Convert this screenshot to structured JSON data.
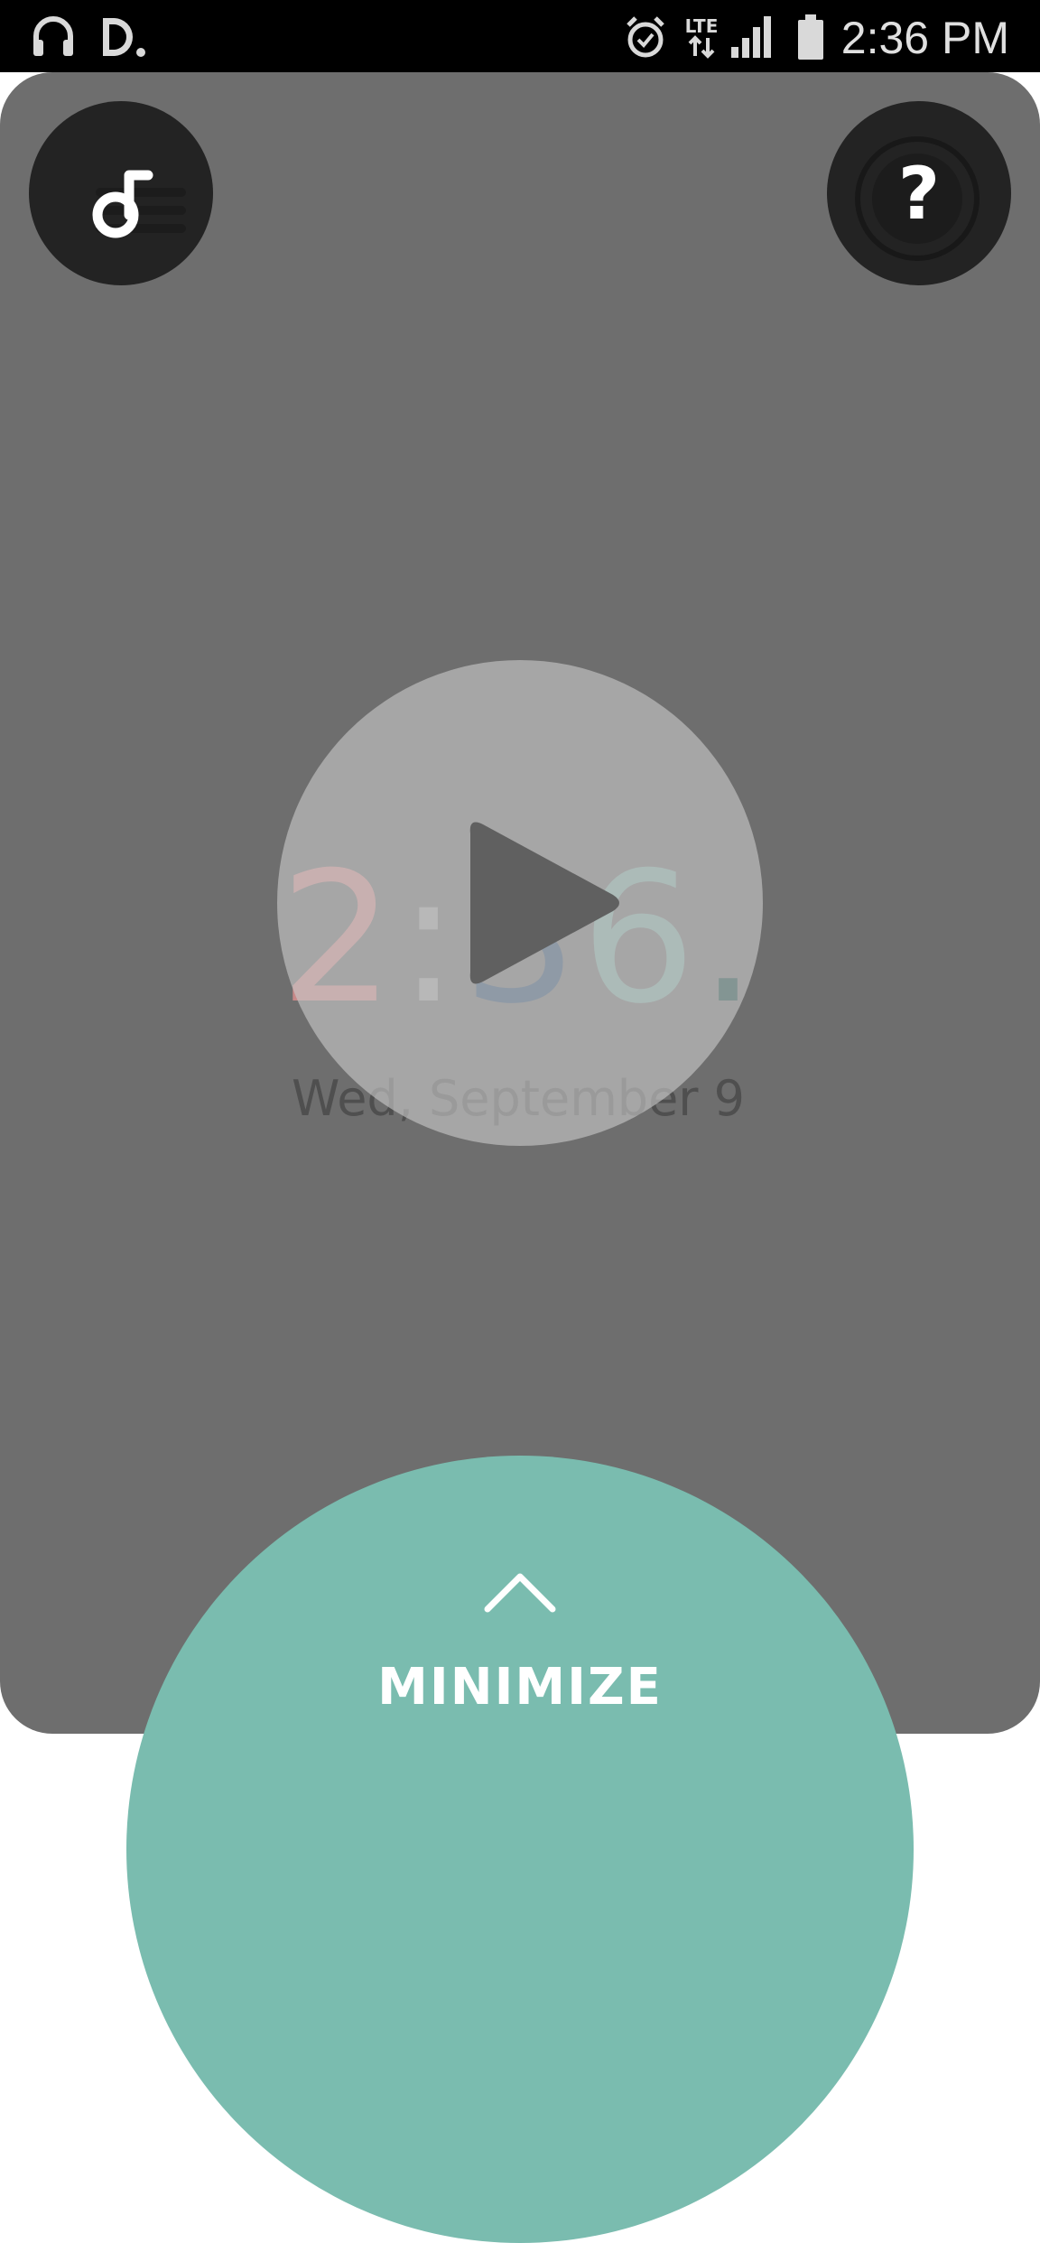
{
  "status_bar": {
    "time": "2:36 PM",
    "network": "LTE",
    "left_icons": [
      "headphones-icon",
      "dashclock-icon"
    ],
    "right_icons": [
      "alarm-icon",
      "lte-icon",
      "signal-icon",
      "battery-icon"
    ]
  },
  "top_buttons": {
    "left_icon": "music-note-icon",
    "right_icon": "help-icon"
  },
  "clock": {
    "hour": "2",
    "separator": ":",
    "minute_tens": "3",
    "minute_ones": "6",
    "trailing_dot": "."
  },
  "date": "Wed, September 9",
  "play_icon": "play-icon",
  "minimize": {
    "label": "MINIMIZE",
    "icon": "chevron-up-icon",
    "color": "#7abcaf"
  },
  "colors": {
    "card": "#6e6e6e",
    "hour": "#c88888",
    "minute_tens": "#34506e",
    "minute_ones": "#7fa59e",
    "dot": "#13423e"
  }
}
